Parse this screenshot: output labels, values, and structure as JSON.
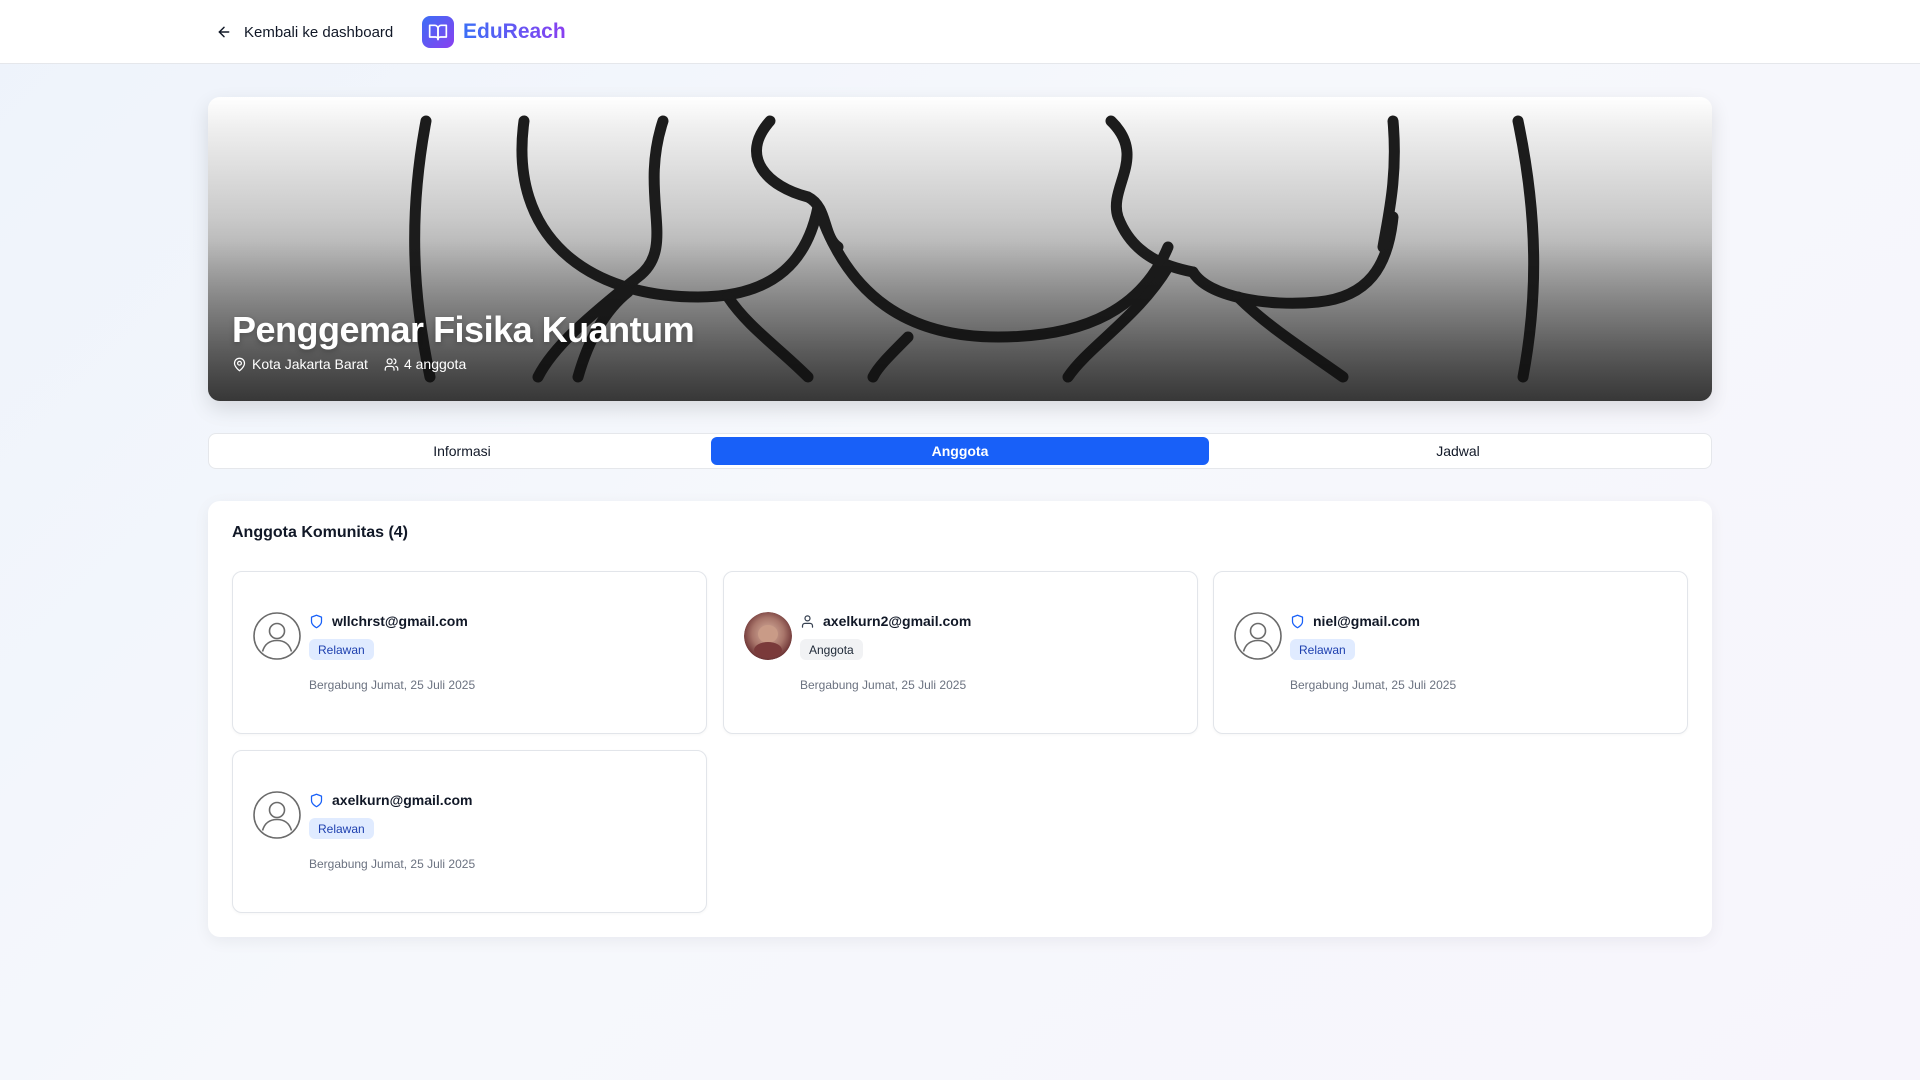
{
  "header": {
    "back_label": "Kembali ke dashboard",
    "brand_name": "EduReach"
  },
  "community": {
    "name": "Penggemar Fisika Kuantum",
    "location": "Kota Jakarta Barat",
    "members_count_label": "4 anggota"
  },
  "tabs": [
    {
      "label": "Informasi",
      "active": false
    },
    {
      "label": "Anggota",
      "active": true
    },
    {
      "label": "Jadwal",
      "active": false
    }
  ],
  "members_section": {
    "title": "Anggota Komunitas (4)",
    "members": [
      {
        "email": "wllchrst@gmail.com",
        "role": "Relawan",
        "role_icon": "shield-icon",
        "avatar": "default-avatar-icon",
        "joined": "Bergabung Jumat, 25 Juli 2025"
      },
      {
        "email": "axelkurn2@gmail.com",
        "role": "Anggota",
        "role_icon": "user-icon",
        "avatar": "photo-avatar",
        "joined": "Bergabung Jumat, 25 Juli 2025"
      },
      {
        "email": "niel@gmail.com",
        "role": "Relawan",
        "role_icon": "shield-icon",
        "avatar": "default-avatar-icon",
        "joined": "Bergabung Jumat, 25 Juli 2025"
      },
      {
        "email": "axelkurn@gmail.com",
        "role": "Relawan",
        "role_icon": "shield-icon",
        "avatar": "default-avatar-icon",
        "joined": "Bergabung Jumat, 25 Juli 2025"
      }
    ]
  },
  "colors": {
    "primary": "#1860f8",
    "brand_gradient_start": "#3b6ff6",
    "brand_gradient_end": "#8a3ff0",
    "relawan_badge_bg": "#e0ebff",
    "relawan_badge_text": "#1e40af"
  }
}
